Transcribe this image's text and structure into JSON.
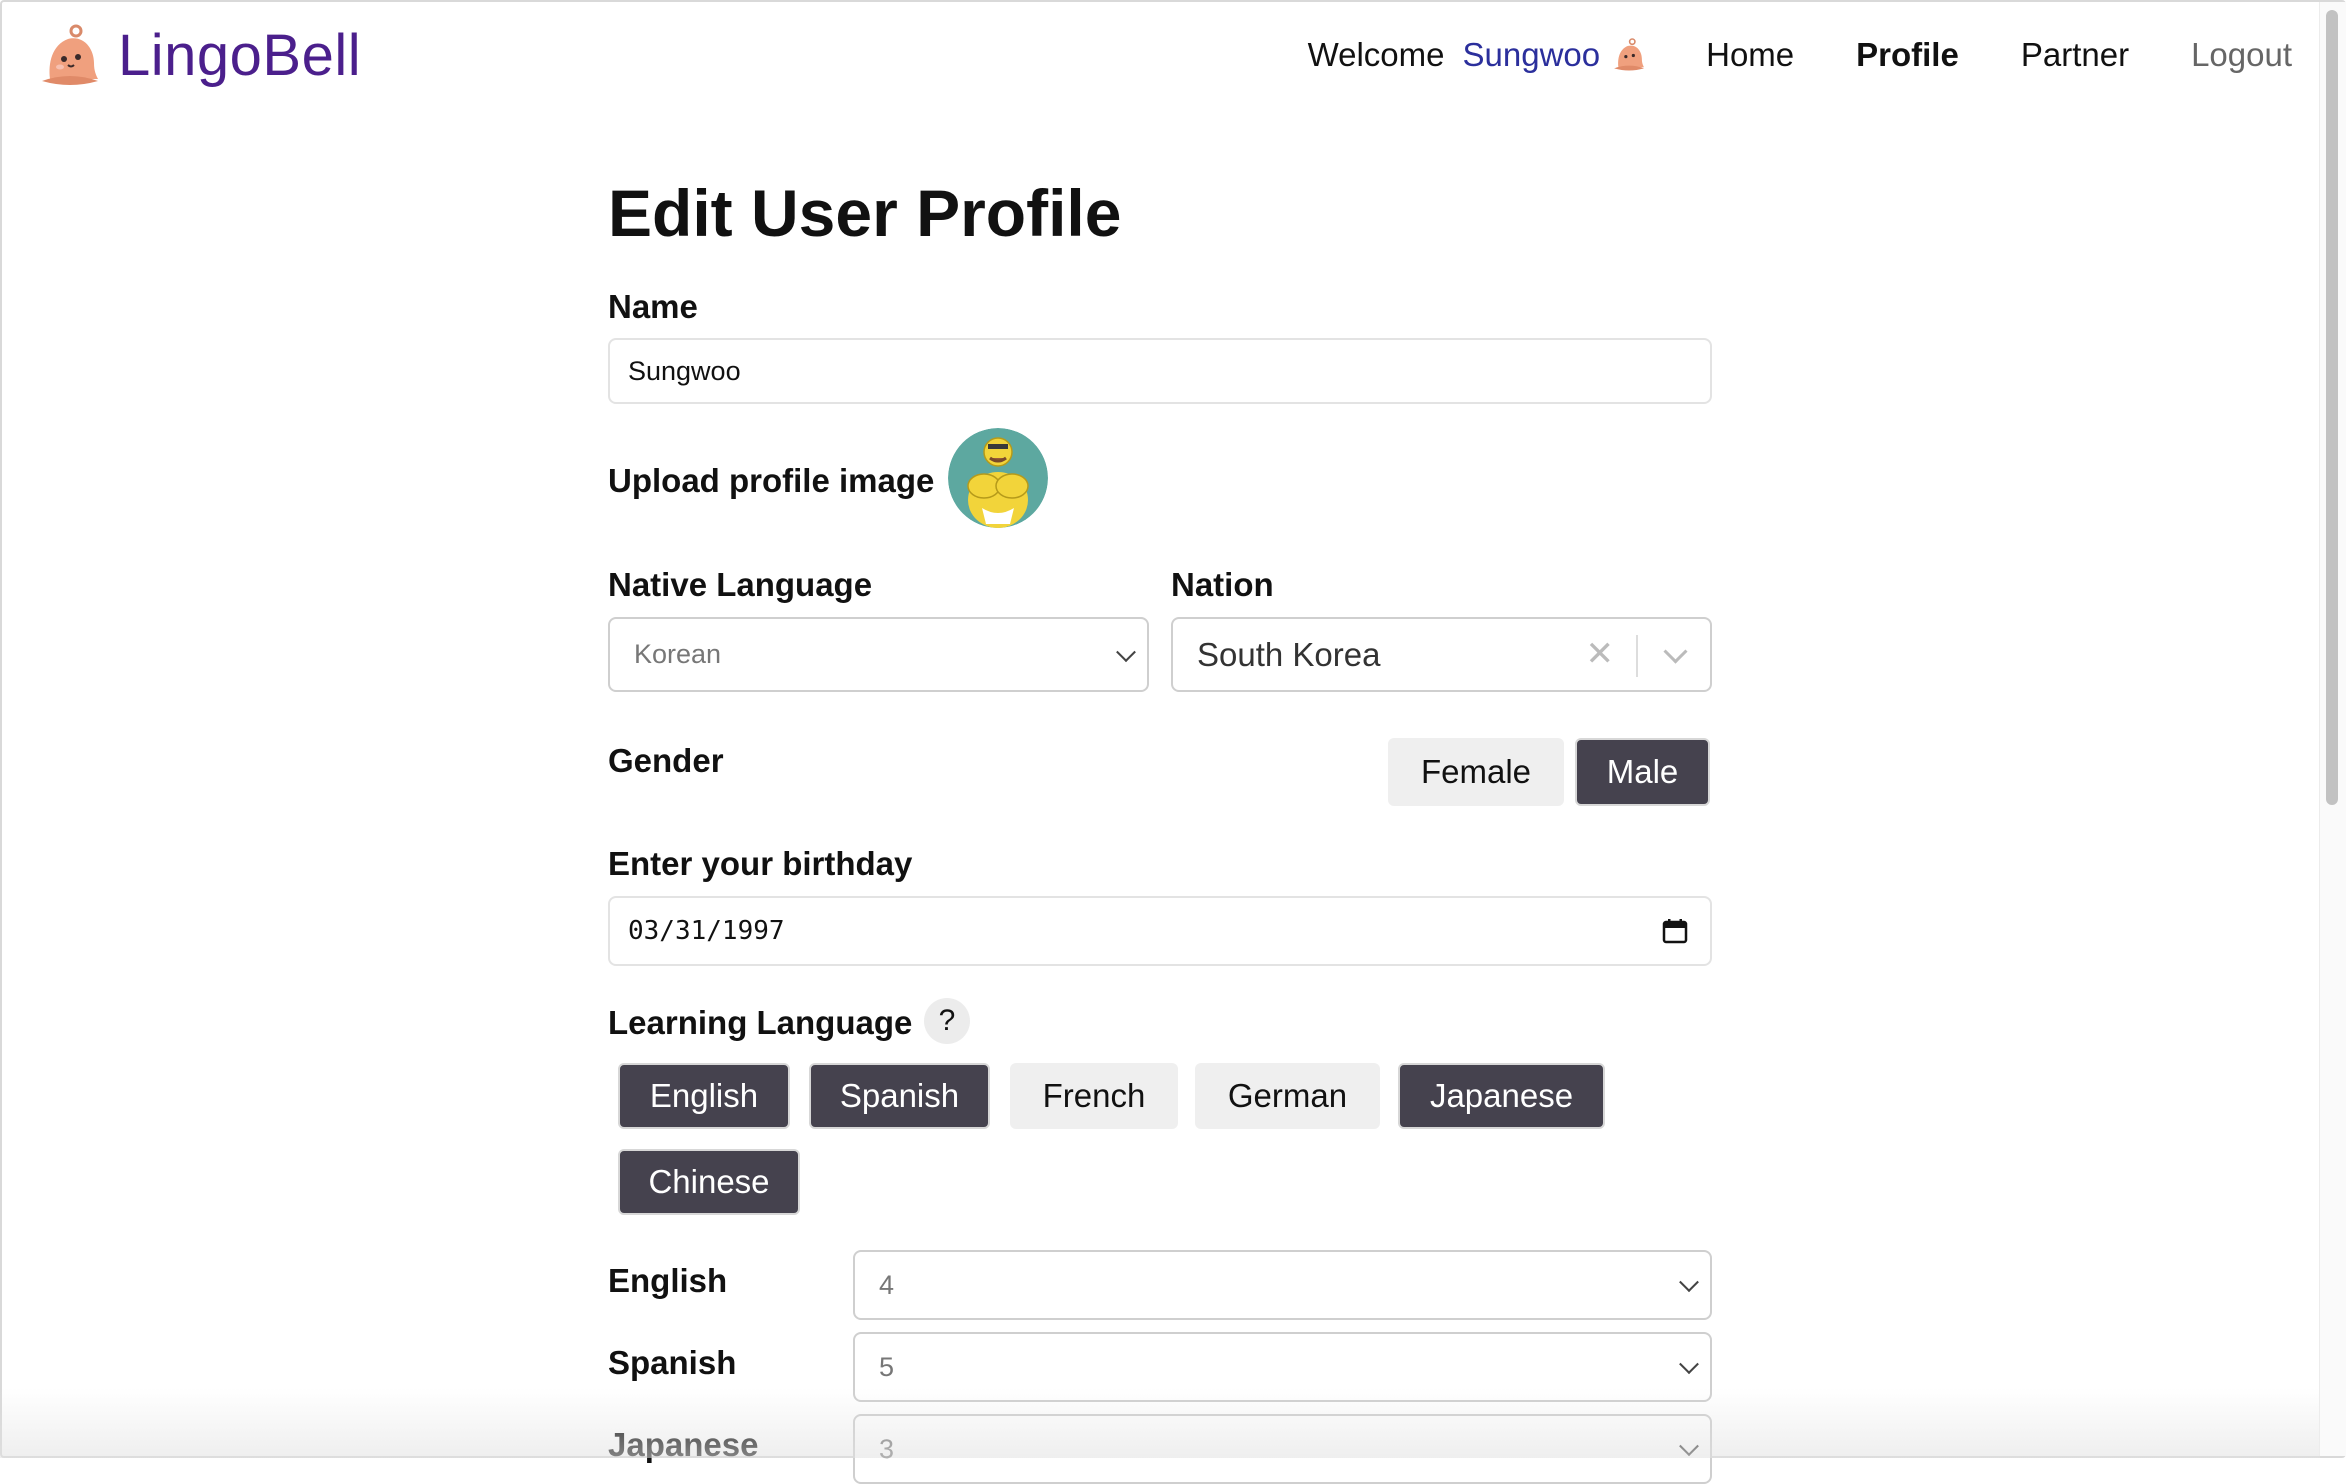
{
  "header": {
    "brand": "LingoBell",
    "welcome_label": "Welcome",
    "username": "Sungwoo",
    "nav": {
      "home": "Home",
      "profile": "Profile",
      "partner": "Partner",
      "logout": "Logout"
    },
    "active_nav": "Profile"
  },
  "form": {
    "title": "Edit User Profile",
    "name": {
      "label": "Name",
      "value": "Sungwoo"
    },
    "profile_image": {
      "label": "Upload profile image"
    },
    "native_language": {
      "label": "Native Language",
      "value": "Korean"
    },
    "nation": {
      "label": "Nation",
      "value": "South Korea",
      "clear_glyph": "✕"
    },
    "gender": {
      "label": "Gender",
      "options": [
        {
          "label": "Female",
          "selected": false
        },
        {
          "label": "Male",
          "selected": true
        }
      ]
    },
    "birthday": {
      "label": "Enter your birthday",
      "value": "03/31/1997"
    },
    "learning_language": {
      "label": "Learning Language",
      "help_glyph": "?",
      "options": [
        {
          "label": "English",
          "selected": true
        },
        {
          "label": "Spanish",
          "selected": true
        },
        {
          "label": "French",
          "selected": false
        },
        {
          "label": "German",
          "selected": false
        },
        {
          "label": "Japanese",
          "selected": true
        },
        {
          "label": "Chinese",
          "selected": true
        }
      ]
    },
    "levels": [
      {
        "language": "English",
        "value": "4"
      },
      {
        "language": "Spanish",
        "value": "5"
      },
      {
        "language": "Japanese",
        "value": "3"
      }
    ]
  },
  "colors": {
    "brand": "#4b1f8c",
    "username": "#2b2f9c",
    "selected_button": "#45424e",
    "unselected_button": "#efefef"
  },
  "icons": {
    "brand": "bell-mascot-icon",
    "welcome": "bell-mascot-icon",
    "avatar": "profile-avatar-image",
    "calendar": "calendar-icon"
  }
}
